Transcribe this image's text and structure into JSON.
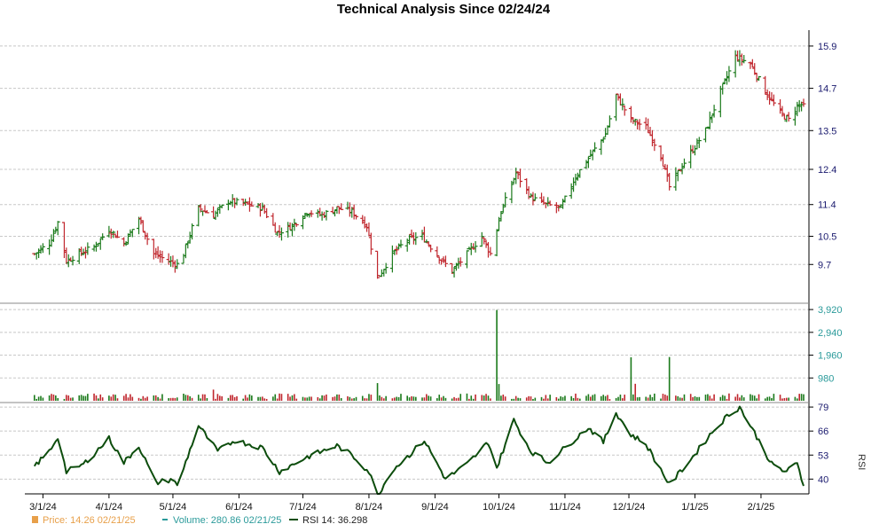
{
  "title": "Technical Analysis Since 02/24/24",
  "colors": {
    "up": "#1b7a1b",
    "down": "#c0262d",
    "grid": "#c8c8c8",
    "axis": "#000000",
    "price_axis_text": "#1a1a6e",
    "volume_axis_text": "#2a9a9a",
    "rsi_line": "#0d4d0d",
    "legend_price": "#e8a04a",
    "legend_volume": "#2a9a9a"
  },
  "legend": {
    "price_label": "Price: 14.26  02/21/25",
    "volume_label": "Volume: 280.86  02/21/25",
    "rsi_label": "RSI 14: 36.298"
  },
  "chart_data": [
    {
      "type": "ohlc",
      "name": "price",
      "title": "Technical Analysis Since 02/24/24",
      "x_tick_labels": [
        "3/1/24",
        "4/1/24",
        "5/1/24",
        "6/1/24",
        "7/1/24",
        "8/1/24",
        "9/1/24",
        "10/1/24",
        "11/1/24",
        "12/1/24",
        "1/1/25",
        "2/1/25"
      ],
      "x_tick_dates": [
        "2024-03-01",
        "2024-04-01",
        "2024-05-01",
        "2024-06-01",
        "2024-07-01",
        "2024-08-01",
        "2024-09-01",
        "2024-10-01",
        "2024-11-01",
        "2024-12-01",
        "2025-01-01",
        "2025-02-01"
      ],
      "x_range": [
        "2024-02-24",
        "2025-02-21"
      ],
      "y_ticks": [
        9.7,
        10.5,
        11.4,
        12.4,
        13.5,
        14.7,
        15.9
      ],
      "y_tick_labels": [
        "9.7",
        "10.5",
        "11.4",
        "12.4",
        "13.5",
        "14.7",
        "15.9"
      ],
      "ylim": [
        8.7,
        16.2
      ],
      "grid": true,
      "close_anchors": [
        {
          "date": "2024-02-26",
          "close": 10.0
        },
        {
          "date": "2024-03-04",
          "close": 10.3
        },
        {
          "date": "2024-03-08",
          "close": 10.9
        },
        {
          "date": "2024-03-12",
          "close": 9.8
        },
        {
          "date": "2024-03-18",
          "close": 10.0
        },
        {
          "date": "2024-03-25",
          "close": 10.2
        },
        {
          "date": "2024-04-01",
          "close": 10.7
        },
        {
          "date": "2024-04-08",
          "close": 10.3
        },
        {
          "date": "2024-04-15",
          "close": 11.0
        },
        {
          "date": "2024-04-22",
          "close": 10.0
        },
        {
          "date": "2024-04-29",
          "close": 9.8
        },
        {
          "date": "2024-05-03",
          "close": 9.7
        },
        {
          "date": "2024-05-06",
          "close": 10.0
        },
        {
          "date": "2024-05-13",
          "close": 11.3
        },
        {
          "date": "2024-05-20",
          "close": 11.1
        },
        {
          "date": "2024-05-27",
          "close": 11.5
        },
        {
          "date": "2024-06-05",
          "close": 11.4
        },
        {
          "date": "2024-06-12",
          "close": 11.3
        },
        {
          "date": "2024-06-19",
          "close": 10.6
        },
        {
          "date": "2024-06-26",
          "close": 10.8
        },
        {
          "date": "2024-07-03",
          "close": 11.2
        },
        {
          "date": "2024-07-10",
          "close": 11.1
        },
        {
          "date": "2024-07-17",
          "close": 11.3
        },
        {
          "date": "2024-07-24",
          "close": 11.2
        },
        {
          "date": "2024-07-31",
          "close": 10.8
        },
        {
          "date": "2024-08-05",
          "close": 9.3
        },
        {
          "date": "2024-08-12",
          "close": 10.0
        },
        {
          "date": "2024-08-19",
          "close": 10.4
        },
        {
          "date": "2024-08-26",
          "close": 10.5
        },
        {
          "date": "2024-09-03",
          "close": 9.9
        },
        {
          "date": "2024-09-09",
          "close": 9.5
        },
        {
          "date": "2024-09-16",
          "close": 10.0
        },
        {
          "date": "2024-09-23",
          "close": 10.5
        },
        {
          "date": "2024-09-27",
          "close": 10.0
        },
        {
          "date": "2024-10-02",
          "close": 11.2
        },
        {
          "date": "2024-10-09",
          "close": 12.3
        },
        {
          "date": "2024-10-16",
          "close": 11.6
        },
        {
          "date": "2024-10-23",
          "close": 11.4
        },
        {
          "date": "2024-10-30",
          "close": 11.3
        },
        {
          "date": "2024-11-06",
          "close": 12.2
        },
        {
          "date": "2024-11-13",
          "close": 12.8
        },
        {
          "date": "2024-11-20",
          "close": 13.4
        },
        {
          "date": "2024-11-25",
          "close": 14.5
        },
        {
          "date": "2024-12-02",
          "close": 13.8
        },
        {
          "date": "2024-12-09",
          "close": 13.6
        },
        {
          "date": "2024-12-16",
          "close": 12.8
        },
        {
          "date": "2024-12-20",
          "close": 11.9
        },
        {
          "date": "2024-12-27",
          "close": 12.6
        },
        {
          "date": "2025-01-06",
          "close": 13.5
        },
        {
          "date": "2025-01-13",
          "close": 14.6
        },
        {
          "date": "2025-01-20",
          "close": 15.6
        },
        {
          "date": "2025-01-27",
          "close": 15.4
        },
        {
          "date": "2025-02-03",
          "close": 14.6
        },
        {
          "date": "2025-02-10",
          "close": 14.0
        },
        {
          "date": "2025-02-14",
          "close": 13.8
        },
        {
          "date": "2025-02-18",
          "close": 14.2
        },
        {
          "date": "2025-02-21",
          "close": 14.26
        }
      ]
    },
    {
      "type": "bar",
      "name": "volume",
      "y_ticks": [
        980,
        1960,
        2940,
        3920
      ],
      "y_tick_labels": [
        "980",
        "1,960",
        "2,940",
        "3,920"
      ],
      "ylim": [
        0,
        4000
      ],
      "baseline_volume": 150,
      "spikes": [
        {
          "date": "2024-05-20",
          "value": 480
        },
        {
          "date": "2024-08-05",
          "value": 760
        },
        {
          "date": "2024-09-30",
          "value": 3900
        },
        {
          "date": "2024-10-01",
          "value": 720
        },
        {
          "date": "2024-12-02",
          "value": 1870
        },
        {
          "date": "2024-12-04",
          "value": 730
        },
        {
          "date": "2024-12-20",
          "value": 1880
        }
      ],
      "last_value": 280.86
    },
    {
      "type": "line",
      "name": "RSI 14",
      "ylabel": "RSI",
      "y_ticks": [
        40,
        53,
        66,
        79
      ],
      "y_tick_labels": [
        "40",
        "53",
        "66",
        "79"
      ],
      "ylim": [
        32,
        80
      ],
      "points": [
        {
          "date": "2024-02-26",
          "value": 47
        },
        {
          "date": "2024-03-04",
          "value": 55
        },
        {
          "date": "2024-03-08",
          "value": 63
        },
        {
          "date": "2024-03-12",
          "value": 44
        },
        {
          "date": "2024-03-20",
          "value": 48
        },
        {
          "date": "2024-04-01",
          "value": 62
        },
        {
          "date": "2024-04-08",
          "value": 49
        },
        {
          "date": "2024-04-15",
          "value": 58
        },
        {
          "date": "2024-04-23",
          "value": 38
        },
        {
          "date": "2024-05-01",
          "value": 40
        },
        {
          "date": "2024-05-03",
          "value": 36
        },
        {
          "date": "2024-05-13",
          "value": 69
        },
        {
          "date": "2024-05-22",
          "value": 55
        },
        {
          "date": "2024-05-30",
          "value": 61
        },
        {
          "date": "2024-06-12",
          "value": 57
        },
        {
          "date": "2024-06-20",
          "value": 44
        },
        {
          "date": "2024-07-03",
          "value": 52
        },
        {
          "date": "2024-07-10",
          "value": 55
        },
        {
          "date": "2024-07-17",
          "value": 58
        },
        {
          "date": "2024-07-24",
          "value": 53
        },
        {
          "date": "2024-08-01",
          "value": 44
        },
        {
          "date": "2024-08-05",
          "value": 31
        },
        {
          "date": "2024-08-12",
          "value": 45
        },
        {
          "date": "2024-08-19",
          "value": 52
        },
        {
          "date": "2024-08-27",
          "value": 61
        },
        {
          "date": "2024-09-06",
          "value": 40
        },
        {
          "date": "2024-09-16",
          "value": 48
        },
        {
          "date": "2024-09-26",
          "value": 60
        },
        {
          "date": "2024-09-30",
          "value": 46
        },
        {
          "date": "2024-10-08",
          "value": 72
        },
        {
          "date": "2024-10-16",
          "value": 55
        },
        {
          "date": "2024-10-24",
          "value": 49
        },
        {
          "date": "2024-11-04",
          "value": 60
        },
        {
          "date": "2024-11-12",
          "value": 68
        },
        {
          "date": "2024-11-19",
          "value": 60
        },
        {
          "date": "2024-11-25",
          "value": 76
        },
        {
          "date": "2024-12-02",
          "value": 64
        },
        {
          "date": "2024-12-09",
          "value": 59
        },
        {
          "date": "2024-12-20",
          "value": 37
        },
        {
          "date": "2024-12-31",
          "value": 52
        },
        {
          "date": "2025-01-08",
          "value": 64
        },
        {
          "date": "2025-01-16",
          "value": 74
        },
        {
          "date": "2025-01-22",
          "value": 79
        },
        {
          "date": "2025-01-29",
          "value": 65
        },
        {
          "date": "2025-02-06",
          "value": 48
        },
        {
          "date": "2025-02-12",
          "value": 44
        },
        {
          "date": "2025-02-18",
          "value": 48
        },
        {
          "date": "2025-02-21",
          "value": 36.298
        }
      ]
    }
  ]
}
